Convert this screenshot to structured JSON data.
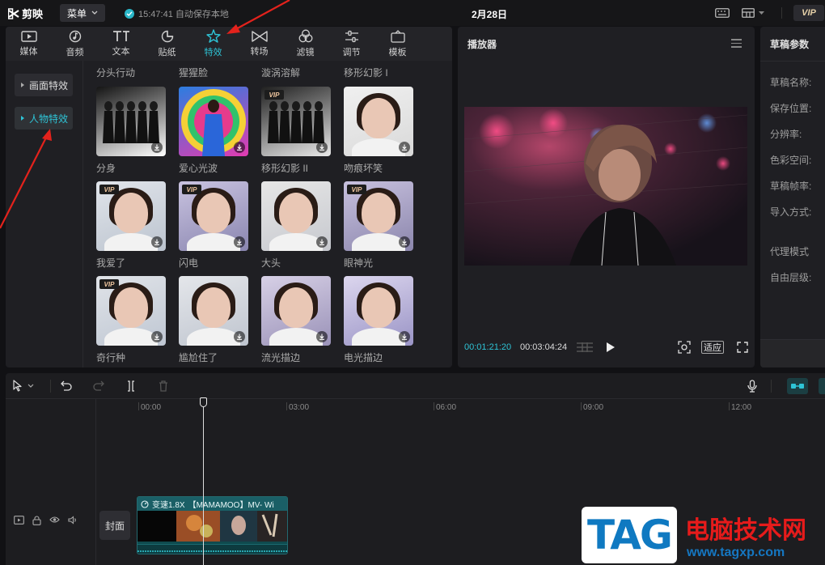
{
  "topbar": {
    "app_name": "剪映",
    "menu_label": "菜单",
    "autosave_text": "15:47:41 自动保存本地",
    "title": "2月28日",
    "vip_label": "VIP"
  },
  "tabs": [
    {
      "label": "媒体",
      "icon": "media-icon"
    },
    {
      "label": "音频",
      "icon": "audio-icon"
    },
    {
      "label": "文本",
      "icon": "text-icon"
    },
    {
      "label": "贴纸",
      "icon": "sticker-icon"
    },
    {
      "label": "特效",
      "icon": "effects-icon",
      "active": true
    },
    {
      "label": "转场",
      "icon": "transition-icon"
    },
    {
      "label": "滤镜",
      "icon": "filter-icon"
    },
    {
      "label": "调节",
      "icon": "adjust-icon"
    },
    {
      "label": "模板",
      "icon": "template-icon"
    }
  ],
  "sidebar": {
    "items": [
      {
        "label": "画面特效"
      },
      {
        "label": "人物特效",
        "active": true
      }
    ]
  },
  "effects": {
    "top_row_labels": [
      "分头行动",
      "猩猩脸",
      "漩涡溶解",
      "移形幻影 I"
    ],
    "rows": [
      [
        {
          "label": "分身",
          "vip": false
        },
        {
          "label": "爱心光波",
          "vip": false
        },
        {
          "label": "移形幻影 II",
          "vip": true
        },
        {
          "label": "吻痕坏笑",
          "vip": false
        }
      ],
      [
        {
          "label": "我爱了",
          "vip": true
        },
        {
          "label": "闪电",
          "vip": true
        },
        {
          "label": "大头",
          "vip": false
        },
        {
          "label": "眼神光",
          "vip": true
        }
      ],
      [
        {
          "label": "奇行种",
          "vip": true
        },
        {
          "label": "尴尬住了",
          "vip": false
        },
        {
          "label": "流光描边",
          "vip": false
        },
        {
          "label": "电光描边",
          "vip": false
        }
      ]
    ],
    "vip_badge": "VIP"
  },
  "player": {
    "title": "播放器",
    "current_time": "00:01:21:20",
    "total_time": "00:03:04:24",
    "fit_label": "适应"
  },
  "draft": {
    "title": "草稿参数",
    "fields": [
      "草稿名称:",
      "保存位置:",
      "分辨率:",
      "色彩空间:",
      "草稿帧率:",
      "导入方式:",
      "代理模式",
      "自由层级:"
    ]
  },
  "timeline": {
    "ruler_labels": [
      "00:00",
      "03:00",
      "06:00",
      "09:00",
      "12:00"
    ],
    "cover_label": "封面",
    "clip_speed": "变速1.8X",
    "clip_title": "【MAMAMOO】MV- Wi"
  },
  "watermark": {
    "tag": "TAG",
    "cn": "电脑技术网",
    "url": "www.tagxp.com"
  },
  "colors": {
    "accent": "#2ec4d6",
    "annotation_arrow": "#e3221c"
  }
}
